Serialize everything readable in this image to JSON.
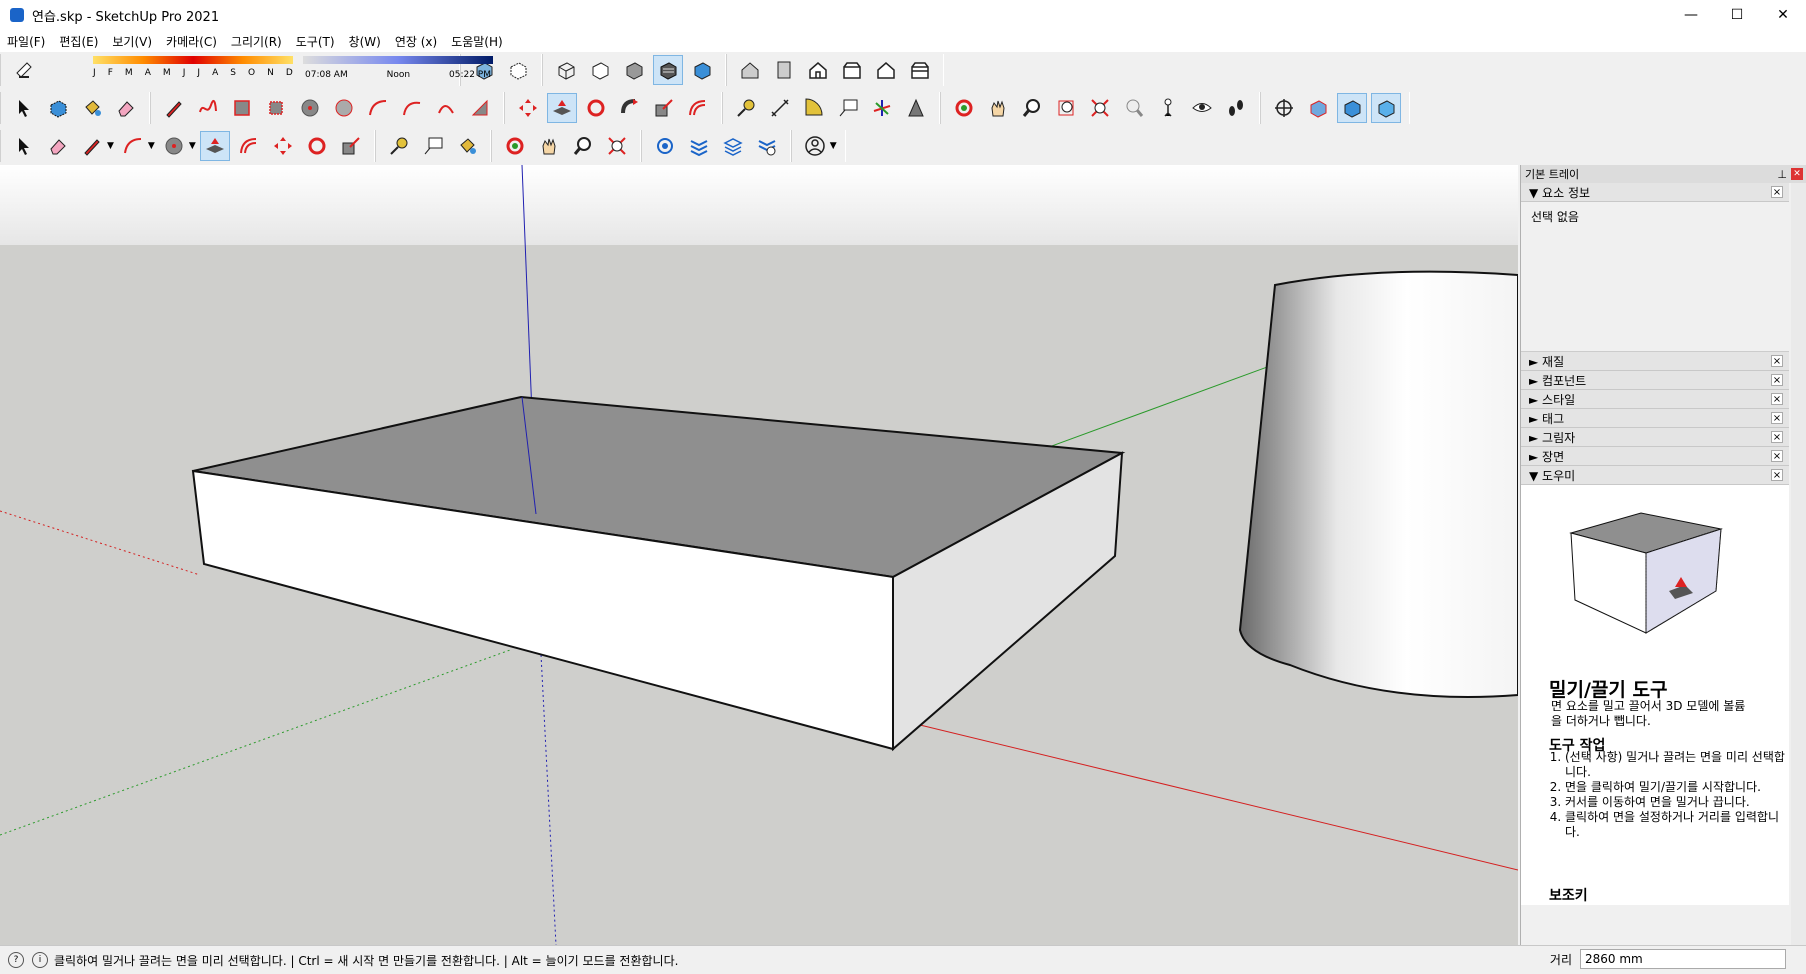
{
  "window": {
    "title": "연습.skp - SketchUp Pro 2021",
    "min": "—",
    "max": "☐",
    "close": "✕"
  },
  "menu": [
    "파일(F)",
    "편집(E)",
    "보기(V)",
    "카메라(C)",
    "그리기(R)",
    "도구(T)",
    "창(W)",
    "연장 (x)",
    "도움말(H)"
  ],
  "shadows": {
    "months": [
      "J",
      "F",
      "M",
      "A",
      "M",
      "J",
      "J",
      "A",
      "S",
      "O",
      "N",
      "D"
    ],
    "time_start": "07:08 AM",
    "time_mid": "Noon",
    "time_end": "05:22 PM"
  },
  "toolbar_icons_row1": [
    "eraser-icon",
    "month-slider",
    "time-slider",
    "xray-icon",
    "backedge-icon",
    "wireframe-icon",
    "hidden-line-icon",
    "shaded-icon",
    "shaded-textures-icon",
    "monochrome-icon",
    "iso-view-icon",
    "top-view-icon",
    "front-view-icon",
    "right-view-icon",
    "back-view-icon",
    "left-view-icon"
  ],
  "tray": {
    "title": "기본 트레이",
    "entity_info": {
      "label": "요소 정보",
      "content": "선택 없음"
    },
    "collapsed": [
      "재질",
      "컴포넌트",
      "스타일",
      "태그",
      "그림자",
      "장면"
    ],
    "helper": {
      "label": "도우미",
      "tool_title": "밀기/끌기 도구",
      "desc": "면 요소를 밀고 끌어서 3D 모델에 볼륨을 더하거나 뺍니다.",
      "steps_title": "도구 작업",
      "steps": [
        "(선택 사항) 밀거나 끌려는 면을 미리 선택합니다.",
        "면을 클릭하여 밀기/끌기를 시작합니다.",
        "커서를 이동하여 면을 밀거나 끕니다.",
        "클릭하여 면을 설정하거나 거리를 입력합니다."
      ],
      "more_title": "보조키"
    }
  },
  "status": {
    "message": "클릭하여 밀거나 끌려는 면을 미리 선택합니다. | Ctrl = 새 시작 면 만들기를 전환합니다. | Alt = 늘이기 모드를 전환합니다.",
    "measure_label": "거리",
    "measure_value": "2860 mm"
  },
  "colors": {
    "sky": "#e8e8e6",
    "ground": "#cfcfcc",
    "red_axis": "#d42020",
    "green_axis": "#2a9a2a",
    "blue_axis": "#2020b0"
  }
}
